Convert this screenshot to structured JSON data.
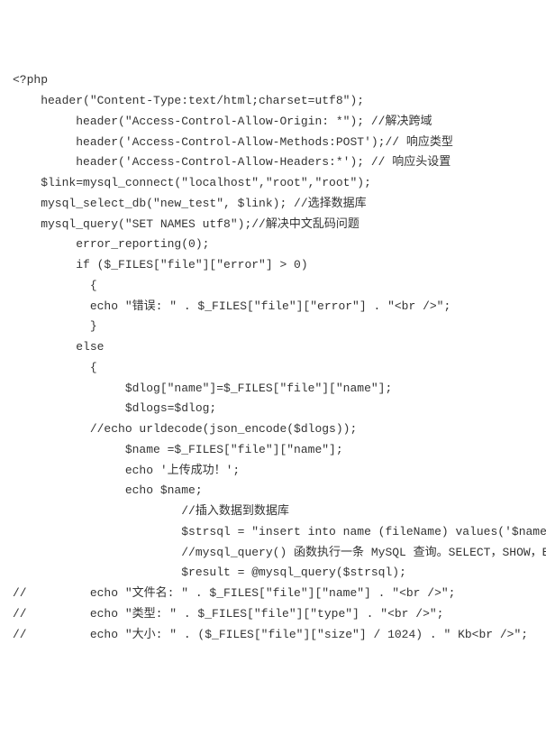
{
  "code": {
    "lines": [
      "<?php",
      "    header(\"Content-Type:text/html;charset=utf8\");",
      "         header(\"Access-Control-Allow-Origin: *\"); //解决跨域",
      "         header('Access-Control-Allow-Methods:POST');// 响应类型",
      "         header('Access-Control-Allow-Headers:*'); // 响应头设置",
      "    $link=mysql_connect(\"localhost\",\"root\",\"root\");",
      "    mysql_select_db(\"new_test\", $link); //选择数据库",
      "    mysql_query(\"SET NAMES utf8\");//解决中文乱码问题",
      "         error_reporting(0);",
      "         if ($_FILES[\"file\"][\"error\"] > 0)",
      "           {",
      "           echo \"错误: \" . $_FILES[\"file\"][\"error\"] . \"<br />\";",
      "           }",
      "         else",
      "           {",
      "                $dlog[\"name\"]=$_FILES[\"file\"][\"name\"];",
      "                $dlogs=$dlog;",
      "           //echo urldecode(json_encode($dlogs));",
      "                $name =$_FILES[\"file\"][\"name\"];",
      "                echo '上传成功！';",
      "                echo $name;",
      "                        //插入数据到数据库",
      "                        $strsql = \"insert into name (fileName) values('$name')\";",
      "                        //mysql_query() 函数执行一条 MySQL 查询。SELECT，SHOW，EXPLAIN",
      "                        $result = @mysql_query($strsql);",
      "//         echo \"文件名: \" . $_FILES[\"file\"][\"name\"] . \"<br />\";",
      "//         echo \"类型: \" . $_FILES[\"file\"][\"type\"] . \"<br />\";",
      "//         echo \"大小: \" . ($_FILES[\"file\"][\"size\"] / 1024) . \" Kb<br />\";"
    ]
  }
}
